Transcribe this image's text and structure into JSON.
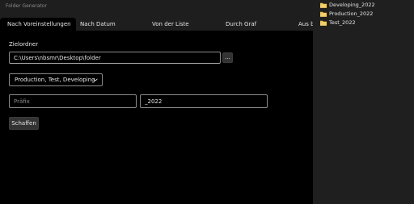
{
  "window": {
    "title": "Folder Generator"
  },
  "tabs": [
    {
      "label": "Nach Voreinstellungen",
      "active": true
    },
    {
      "label": "Nach Datum",
      "active": false
    },
    {
      "label": "Von der Liste",
      "active": false
    },
    {
      "label": "Durch Graf",
      "active": false
    },
    {
      "label": "Aus b",
      "active": false
    }
  ],
  "form": {
    "target_folder_label": "Zielordner",
    "target_folder_value": "C:\\Users\\nbsmr\\Desktop\\folder",
    "browse_label": "...",
    "preset_selected": "Production, Test, Developing",
    "prefix_placeholder": "Präfix",
    "prefix_value": "",
    "suffix_value": "_2022",
    "create_label": "Schaffen"
  },
  "explorer": {
    "items": [
      {
        "name": "Developing_2022",
        "icon": "folder-icon"
      },
      {
        "name": "Production_2022",
        "icon": "folder-icon"
      },
      {
        "name": "Test_2022",
        "icon": "folder-icon"
      }
    ]
  },
  "colors": {
    "accent_folder": "#e8c35a",
    "background": "#000000",
    "panel": "#1f1f1f"
  }
}
